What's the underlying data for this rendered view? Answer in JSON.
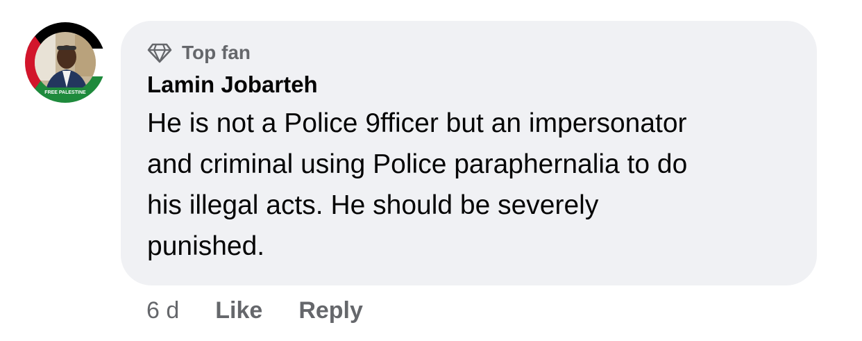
{
  "comment": {
    "badge_icon": "diamond-icon",
    "badge_label": "Top fan",
    "author": "Lamin Jobarteh",
    "text": "He is not a Police 9fficer but an impersonator\nand criminal using Police paraphernalia to do\nhis illegal acts. He should be severely\npunished.",
    "avatar_frame_text": "FREE PALESTINE",
    "time": "6 d",
    "like_label": "Like",
    "reply_label": "Reply"
  },
  "colors": {
    "bubble_bg": "#f0f1f4",
    "secondary_text": "#65676b",
    "primary_text": "#050505",
    "frame_black": "#000000",
    "frame_green": "#1e8a3c",
    "frame_red": "#d2152b"
  }
}
